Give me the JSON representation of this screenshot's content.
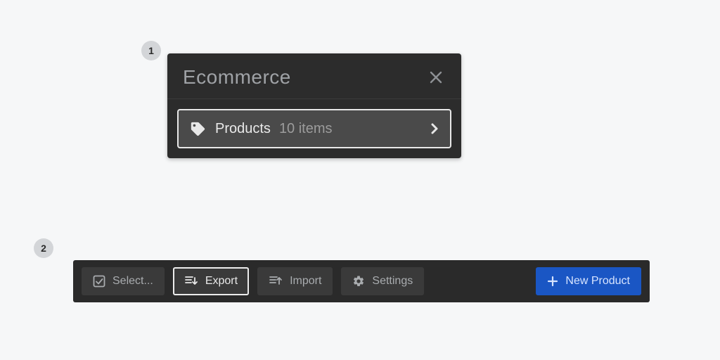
{
  "steps": {
    "one": "1",
    "two": "2"
  },
  "panel": {
    "title": "Ecommerce",
    "row": {
      "label": "Products",
      "count": "10 items"
    }
  },
  "toolbar": {
    "select": "Select...",
    "export": "Export",
    "import": "Import",
    "settings": "Settings",
    "new_product": "New Product"
  }
}
